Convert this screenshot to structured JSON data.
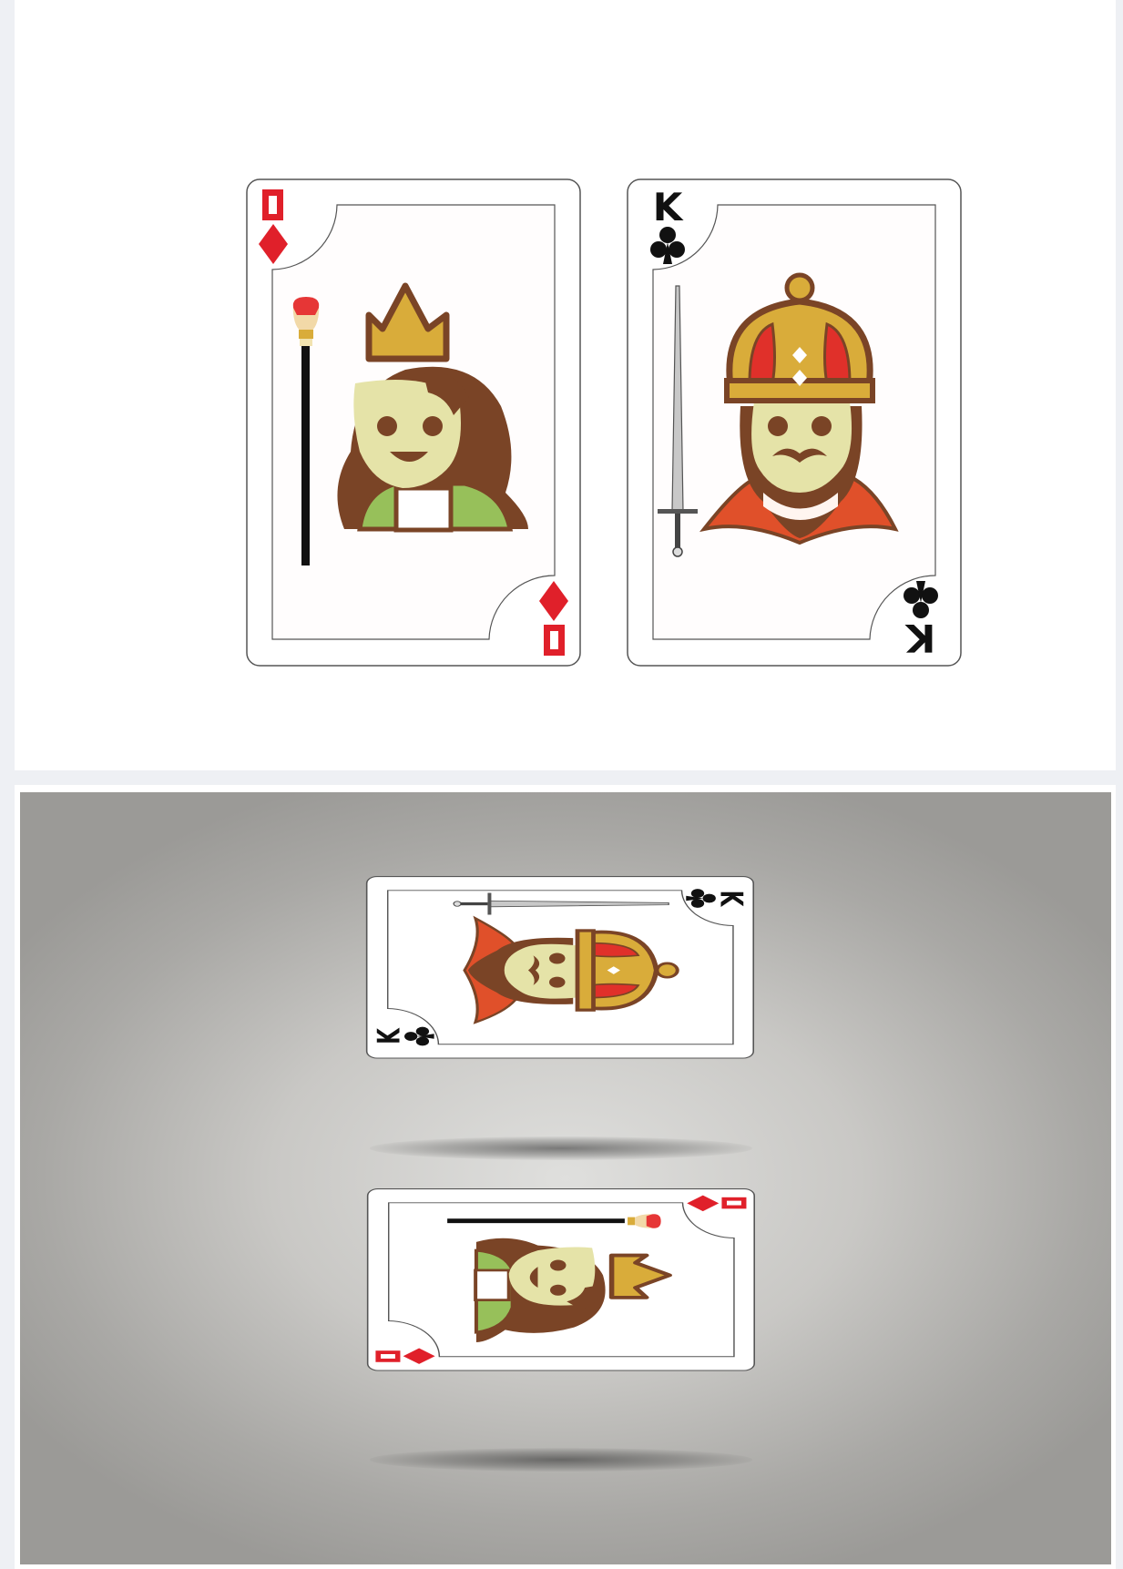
{
  "colors": {
    "diamond_red": "#e0202a",
    "club_black": "#111111",
    "hair_brown": "#7a4426",
    "skin": "#e5e3a8",
    "crown_gold": "#d9ac3a",
    "dress_green": "#97c05a",
    "robe_red": "#e0502a",
    "scepter_black": "#111111",
    "sword_silver": "#b8b8b8",
    "backdrop_gray": "#c9c8c5"
  },
  "queen_card": {
    "rank": "Q",
    "suit": "diamond",
    "figure": "queen-figure",
    "item": "scepter-icon"
  },
  "king_card": {
    "rank": "K",
    "suit": "club",
    "figure": "king-figure",
    "item": "sword-icon"
  },
  "mockup": {
    "cards": [
      "king_card",
      "queen_card"
    ],
    "orientation": "rotated-90"
  }
}
